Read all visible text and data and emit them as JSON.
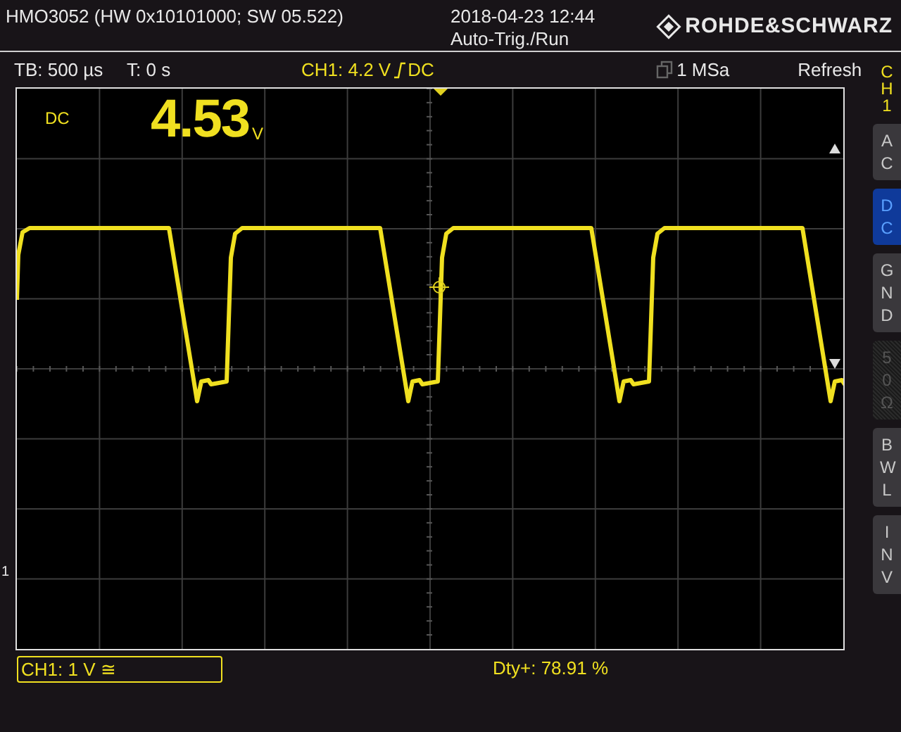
{
  "header": {
    "title": "HMO3052 (HW 0x10101000; SW 05.522)",
    "datetime": "2018-04-23 12:44",
    "trigger_status": "Auto-Trig./Run",
    "brand": "ROHDE&SCHWARZ"
  },
  "status_row": {
    "timebase": "TB: 500 µs",
    "trigger_time": "T: 0 s",
    "trigger_level": "CH1: 4.2 V",
    "trigger_coupling": "DC",
    "sample_rate": "1 MSa",
    "acquisition_mode": "Refresh"
  },
  "display": {
    "coupling_label": "DC",
    "readout": "4.53",
    "readout_unit": "V",
    "ground_marker": "1"
  },
  "channel_menu": {
    "title": "CH1",
    "buttons": [
      {
        "label": "AC",
        "selected": false,
        "disabled": false
      },
      {
        "label": "DC",
        "selected": true,
        "disabled": false
      },
      {
        "label": "GND",
        "selected": false,
        "disabled": false
      },
      {
        "label": "50Ω",
        "selected": false,
        "disabled": true
      },
      {
        "label": "BWL",
        "selected": false,
        "disabled": false
      },
      {
        "label": "INV",
        "selected": false,
        "disabled": false
      }
    ]
  },
  "footer": {
    "channel_scale": "CH1: 1 V ≅",
    "measurement": "Dty+: 78.91 %"
  }
}
